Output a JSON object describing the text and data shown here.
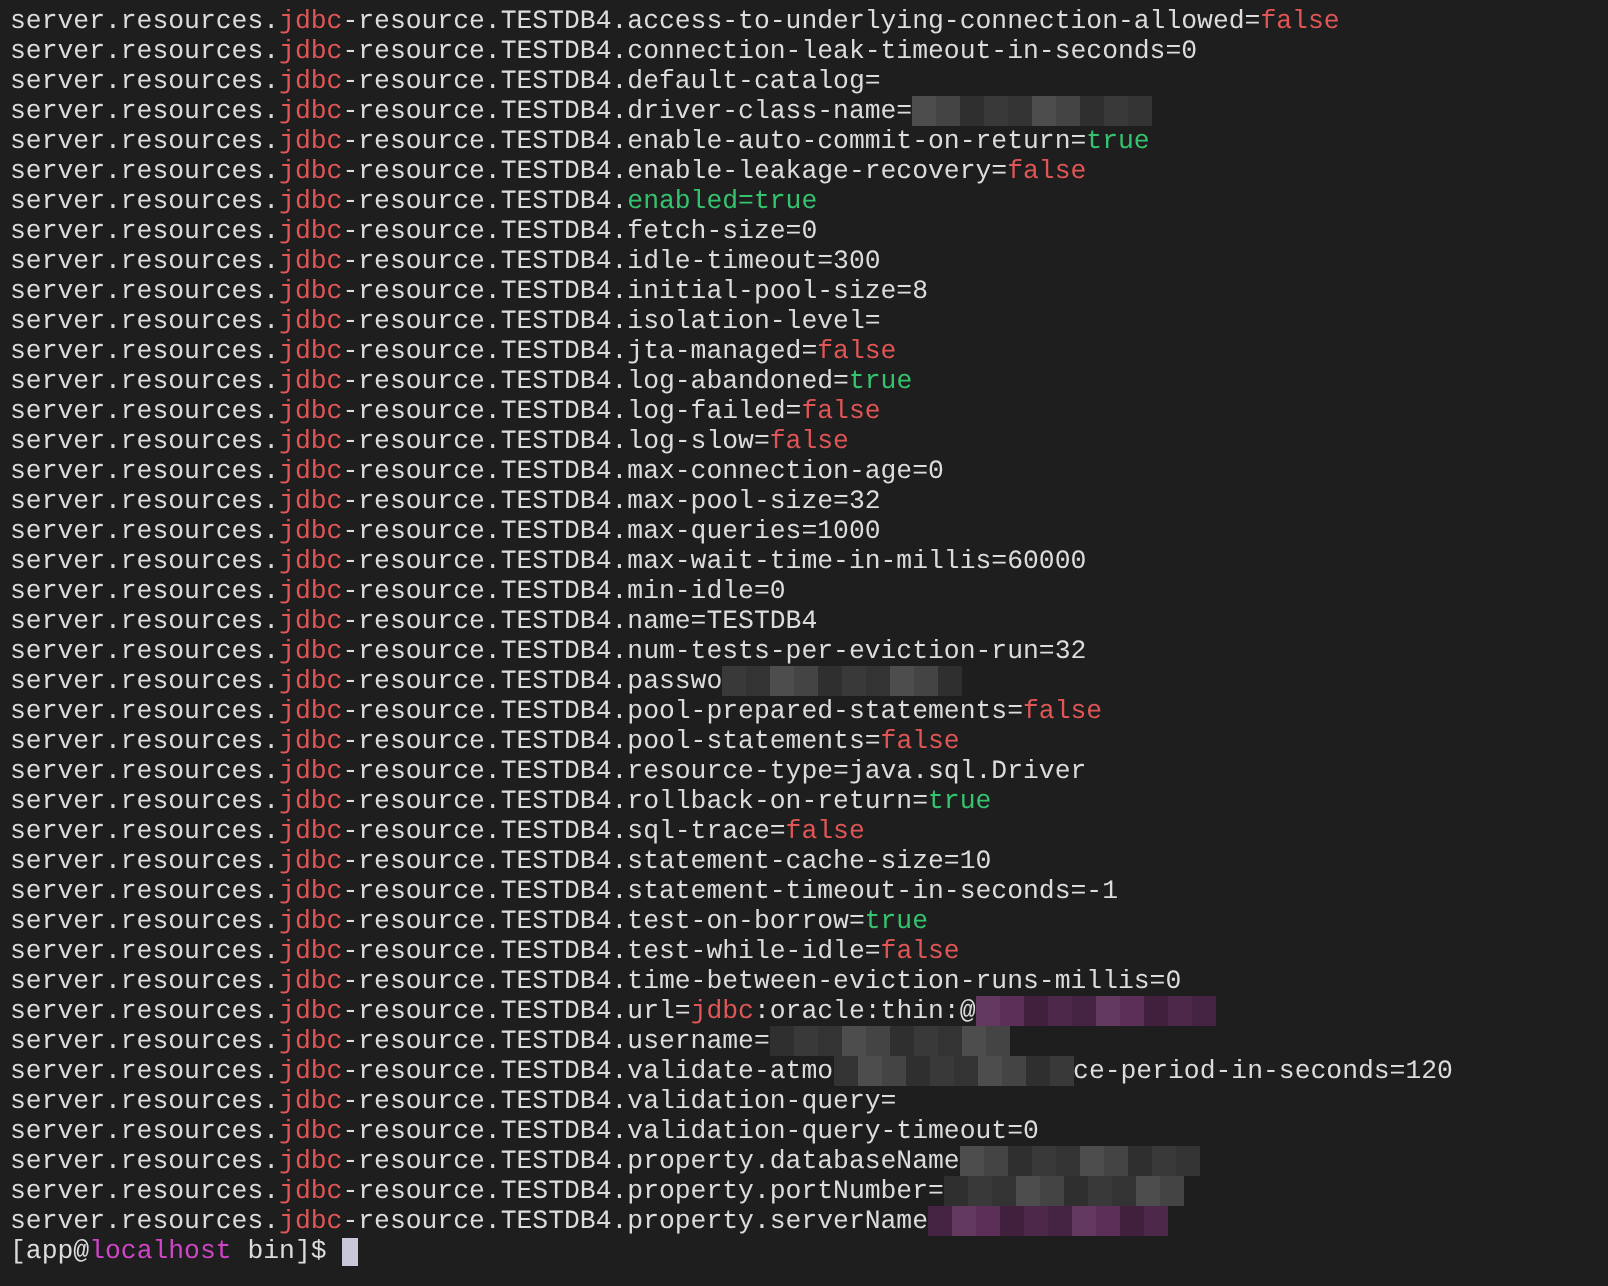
{
  "lines": [
    {
      "segments": [
        {
          "kind": "plain",
          "text": "server.resources."
        },
        {
          "kind": "keyword",
          "text": "jdbc"
        },
        {
          "kind": "plain",
          "text": "-resource.TESTDB4.access-to-underlying-connection-allowed="
        },
        {
          "kind": "false",
          "text": "false"
        }
      ]
    },
    {
      "segments": [
        {
          "kind": "plain",
          "text": "server.resources."
        },
        {
          "kind": "keyword",
          "text": "jdbc"
        },
        {
          "kind": "plain",
          "text": "-resource.TESTDB4.connection-leak-timeout-in-seconds=0"
        }
      ]
    },
    {
      "segments": [
        {
          "kind": "plain",
          "text": "server.resources."
        },
        {
          "kind": "keyword",
          "text": "jdbc"
        },
        {
          "kind": "plain",
          "text": "-resource.TESTDB4.default-catalog="
        }
      ]
    },
    {
      "segments": [
        {
          "kind": "plain",
          "text": "server.resources."
        },
        {
          "kind": "keyword",
          "text": "jdbc"
        },
        {
          "kind": "plain",
          "text": "-resource.TESTDB4.driver-class-name="
        },
        {
          "kind": "mosaic",
          "color": "#444444"
        }
      ]
    },
    {
      "segments": [
        {
          "kind": "plain",
          "text": "server.resources."
        },
        {
          "kind": "keyword",
          "text": "jdbc"
        },
        {
          "kind": "plain",
          "text": "-resource.TESTDB4.enable-auto-commit-on-return="
        },
        {
          "kind": "true",
          "text": "true"
        }
      ]
    },
    {
      "segments": [
        {
          "kind": "plain",
          "text": "server.resources."
        },
        {
          "kind": "keyword",
          "text": "jdbc"
        },
        {
          "kind": "plain",
          "text": "-resource.TESTDB4.enable-leakage-recovery="
        },
        {
          "kind": "false",
          "text": "false"
        }
      ]
    },
    {
      "segments": [
        {
          "kind": "plain",
          "text": "server.resources."
        },
        {
          "kind": "keyword",
          "text": "jdbc"
        },
        {
          "kind": "plain",
          "text": "-resource.TESTDB4."
        },
        {
          "kind": "true",
          "text": "enabled=true"
        }
      ]
    },
    {
      "segments": [
        {
          "kind": "plain",
          "text": "server.resources."
        },
        {
          "kind": "keyword",
          "text": "jdbc"
        },
        {
          "kind": "plain",
          "text": "-resource.TESTDB4.fetch-size=0"
        }
      ]
    },
    {
      "segments": [
        {
          "kind": "plain",
          "text": "server.resources."
        },
        {
          "kind": "keyword",
          "text": "jdbc"
        },
        {
          "kind": "plain",
          "text": "-resource.TESTDB4.idle-timeout=300"
        }
      ]
    },
    {
      "segments": [
        {
          "kind": "plain",
          "text": "server.resources."
        },
        {
          "kind": "keyword",
          "text": "jdbc"
        },
        {
          "kind": "plain",
          "text": "-resource.TESTDB4.initial-pool-size=8"
        }
      ]
    },
    {
      "segments": [
        {
          "kind": "plain",
          "text": "server.resources."
        },
        {
          "kind": "keyword",
          "text": "jdbc"
        },
        {
          "kind": "plain",
          "text": "-resource.TESTDB4.isolation-level="
        }
      ]
    },
    {
      "segments": [
        {
          "kind": "plain",
          "text": "server.resources."
        },
        {
          "kind": "keyword",
          "text": "jdbc"
        },
        {
          "kind": "plain",
          "text": "-resource.TESTDB4.jta-managed="
        },
        {
          "kind": "false",
          "text": "false"
        }
      ]
    },
    {
      "segments": [
        {
          "kind": "plain",
          "text": "server.resources."
        },
        {
          "kind": "keyword",
          "text": "jdbc"
        },
        {
          "kind": "plain",
          "text": "-resource.TESTDB4.log-abandoned="
        },
        {
          "kind": "true",
          "text": "true"
        }
      ]
    },
    {
      "segments": [
        {
          "kind": "plain",
          "text": "server.resources."
        },
        {
          "kind": "keyword",
          "text": "jdbc"
        },
        {
          "kind": "plain",
          "text": "-resource.TESTDB4.log-failed="
        },
        {
          "kind": "false",
          "text": "false"
        }
      ]
    },
    {
      "segments": [
        {
          "kind": "plain",
          "text": "server.resources."
        },
        {
          "kind": "keyword",
          "text": "jdbc"
        },
        {
          "kind": "plain",
          "text": "-resource.TESTDB4.log-slow="
        },
        {
          "kind": "false",
          "text": "false"
        }
      ]
    },
    {
      "segments": [
        {
          "kind": "plain",
          "text": "server.resources."
        },
        {
          "kind": "keyword",
          "text": "jdbc"
        },
        {
          "kind": "plain",
          "text": "-resource.TESTDB4.max-connection-age=0"
        }
      ]
    },
    {
      "segments": [
        {
          "kind": "plain",
          "text": "server.resources."
        },
        {
          "kind": "keyword",
          "text": "jdbc"
        },
        {
          "kind": "plain",
          "text": "-resource.TESTDB4.max-pool-size=32"
        }
      ]
    },
    {
      "segments": [
        {
          "kind": "plain",
          "text": "server.resources."
        },
        {
          "kind": "keyword",
          "text": "jdbc"
        },
        {
          "kind": "plain",
          "text": "-resource.TESTDB4.max-queries=1000"
        }
      ]
    },
    {
      "segments": [
        {
          "kind": "plain",
          "text": "server.resources."
        },
        {
          "kind": "keyword",
          "text": "jdbc"
        },
        {
          "kind": "plain",
          "text": "-resource.TESTDB4.max-wait-time-in-millis=60000"
        }
      ]
    },
    {
      "segments": [
        {
          "kind": "plain",
          "text": "server.resources."
        },
        {
          "kind": "keyword",
          "text": "jdbc"
        },
        {
          "kind": "plain",
          "text": "-resource.TESTDB4.min-idle=0"
        }
      ]
    },
    {
      "segments": [
        {
          "kind": "plain",
          "text": "server.resources."
        },
        {
          "kind": "keyword",
          "text": "jdbc"
        },
        {
          "kind": "plain",
          "text": "-resource.TESTDB4.name=TESTDB4"
        }
      ]
    },
    {
      "segments": [
        {
          "kind": "plain",
          "text": "server.resources."
        },
        {
          "kind": "keyword",
          "text": "jdbc"
        },
        {
          "kind": "plain",
          "text": "-resource.TESTDB4.num-tests-per-eviction-run=32"
        }
      ]
    },
    {
      "segments": [
        {
          "kind": "plain",
          "text": "server.resources."
        },
        {
          "kind": "keyword",
          "text": "jdbc"
        },
        {
          "kind": "plain",
          "text": "-resource.TESTDB4.passwo"
        },
        {
          "kind": "mosaic",
          "color": "#444444"
        }
      ]
    },
    {
      "segments": [
        {
          "kind": "plain",
          "text": "server.resources."
        },
        {
          "kind": "keyword",
          "text": "jdbc"
        },
        {
          "kind": "plain",
          "text": "-resource.TESTDB4.pool-prepared-statements="
        },
        {
          "kind": "false",
          "text": "false"
        }
      ]
    },
    {
      "segments": [
        {
          "kind": "plain",
          "text": "server.resources."
        },
        {
          "kind": "keyword",
          "text": "jdbc"
        },
        {
          "kind": "plain",
          "text": "-resource.TESTDB4.pool-statements="
        },
        {
          "kind": "false",
          "text": "false"
        }
      ]
    },
    {
      "segments": [
        {
          "kind": "plain",
          "text": "server.resources."
        },
        {
          "kind": "keyword",
          "text": "jdbc"
        },
        {
          "kind": "plain",
          "text": "-resource.TESTDB4.resource-type=java.sql.Driver"
        }
      ]
    },
    {
      "segments": [
        {
          "kind": "plain",
          "text": "server.resources."
        },
        {
          "kind": "keyword",
          "text": "jdbc"
        },
        {
          "kind": "plain",
          "text": "-resource.TESTDB4.rollback-on-return="
        },
        {
          "kind": "true",
          "text": "true"
        }
      ]
    },
    {
      "segments": [
        {
          "kind": "plain",
          "text": "server.resources."
        },
        {
          "kind": "keyword",
          "text": "jdbc"
        },
        {
          "kind": "plain",
          "text": "-resource.TESTDB4.sql-trace="
        },
        {
          "kind": "false",
          "text": "false"
        }
      ]
    },
    {
      "segments": [
        {
          "kind": "plain",
          "text": "server.resources."
        },
        {
          "kind": "keyword",
          "text": "jdbc"
        },
        {
          "kind": "plain",
          "text": "-resource.TESTDB4.statement-cache-size=10"
        }
      ]
    },
    {
      "segments": [
        {
          "kind": "plain",
          "text": "server.resources."
        },
        {
          "kind": "keyword",
          "text": "jdbc"
        },
        {
          "kind": "plain",
          "text": "-resource.TESTDB4.statement-timeout-in-seconds=-1"
        }
      ]
    },
    {
      "segments": [
        {
          "kind": "plain",
          "text": "server.resources."
        },
        {
          "kind": "keyword",
          "text": "jdbc"
        },
        {
          "kind": "plain",
          "text": "-resource.TESTDB4.test-on-borrow="
        },
        {
          "kind": "true",
          "text": "true"
        }
      ]
    },
    {
      "segments": [
        {
          "kind": "plain",
          "text": "server.resources."
        },
        {
          "kind": "keyword",
          "text": "jdbc"
        },
        {
          "kind": "plain",
          "text": "-resource.TESTDB4.test-while-idle="
        },
        {
          "kind": "false",
          "text": "false"
        }
      ]
    },
    {
      "segments": [
        {
          "kind": "plain",
          "text": "server.resources."
        },
        {
          "kind": "keyword",
          "text": "jdbc"
        },
        {
          "kind": "plain",
          "text": "-resource.TESTDB4.time-between-eviction-runs-millis=0"
        }
      ]
    },
    {
      "segments": [
        {
          "kind": "plain",
          "text": "server.resources."
        },
        {
          "kind": "keyword",
          "text": "jdbc"
        },
        {
          "kind": "plain",
          "text": "-resource.TESTDB4.url="
        },
        {
          "kind": "keyword",
          "text": "jdbc"
        },
        {
          "kind": "plain",
          "text": ":oracle:thin:@"
        },
        {
          "kind": "mosaic",
          "color": "#5c2f58"
        }
      ]
    },
    {
      "segments": [
        {
          "kind": "plain",
          "text": "server.resources."
        },
        {
          "kind": "keyword",
          "text": "jdbc"
        },
        {
          "kind": "plain",
          "text": "-resource.TESTDB4.username="
        },
        {
          "kind": "mosaic",
          "color": "#444444"
        }
      ]
    },
    {
      "segments": [
        {
          "kind": "plain",
          "text": "server.resources."
        },
        {
          "kind": "keyword",
          "text": "jdbc"
        },
        {
          "kind": "plain",
          "text": "-resource.TESTDB4.validate-atmo"
        },
        {
          "kind": "mosaic",
          "color": "#444444"
        },
        {
          "kind": "plain",
          "text": "ce-period-in-seconds=120"
        }
      ]
    },
    {
      "segments": [
        {
          "kind": "plain",
          "text": "server.resources."
        },
        {
          "kind": "keyword",
          "text": "jdbc"
        },
        {
          "kind": "plain",
          "text": "-resource.TESTDB4.validation-query="
        }
      ]
    },
    {
      "segments": [
        {
          "kind": "plain",
          "text": "server.resources."
        },
        {
          "kind": "keyword",
          "text": "jdbc"
        },
        {
          "kind": "plain",
          "text": "-resource.TESTDB4.validation-query-timeout=0"
        }
      ]
    },
    {
      "segments": [
        {
          "kind": "plain",
          "text": "server.resources."
        },
        {
          "kind": "keyword",
          "text": "jdbc"
        },
        {
          "kind": "plain",
          "text": "-resource.TESTDB4.property.databaseName"
        },
        {
          "kind": "mosaic",
          "color": "#444444"
        }
      ]
    },
    {
      "segments": [
        {
          "kind": "plain",
          "text": "server.resources."
        },
        {
          "kind": "keyword",
          "text": "jdbc"
        },
        {
          "kind": "plain",
          "text": "-resource.TESTDB4.property.portNumber="
        },
        {
          "kind": "mosaic",
          "color": "#444444"
        }
      ]
    },
    {
      "segments": [
        {
          "kind": "plain",
          "text": "server.resources."
        },
        {
          "kind": "keyword",
          "text": "jdbc"
        },
        {
          "kind": "plain",
          "text": "-resource.TESTDB4.property.serverName"
        },
        {
          "kind": "mosaic",
          "color": "#5c2f58"
        }
      ]
    }
  ],
  "prompt": {
    "segments": [
      {
        "kind": "plain",
        "text": "[app@"
      },
      {
        "kind": "host",
        "text": "localhost"
      },
      {
        "kind": "plain",
        "text": " bin]$ "
      }
    ],
    "cursor_visible": true
  }
}
